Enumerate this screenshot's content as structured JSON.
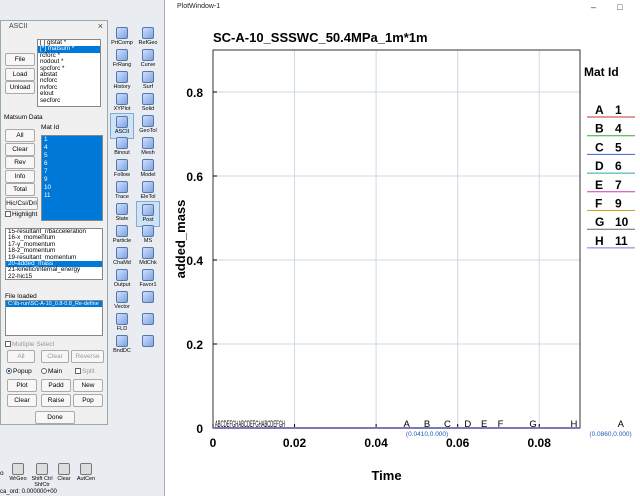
{
  "ascii_dialog": {
    "title": "ASCII",
    "close": "×",
    "file_buttons": [
      "File",
      "Load",
      "Unload"
    ],
    "file_list": [
      {
        "text": "[ ] glstat *",
        "selected": false
      },
      {
        "text": "[*] matsum *",
        "selected": true
      },
      {
        "text": "rcforc *",
        "selected": false
      },
      {
        "text": "nodout *",
        "selected": false
      },
      {
        "text": "spcforc *",
        "selected": false
      },
      {
        "text": "abstat",
        "selected": false
      },
      {
        "text": "ncforc",
        "selected": false
      },
      {
        "text": "nvforc",
        "selected": false
      },
      {
        "text": "elout",
        "selected": false
      },
      {
        "text": "secforc",
        "selected": false
      }
    ],
    "matsum_label": "Matsum Data",
    "mat_id_label": "Mat Id",
    "left_buttons": [
      "All",
      "Clear",
      "Rev",
      "Info",
      "Total",
      "Hic/Csi/Dri"
    ],
    "highlight_label": "Highlight",
    "mat_ids": [
      "1",
      "4",
      "5",
      "6",
      "7",
      "9",
      "10",
      "11"
    ],
    "component_list": [
      {
        "text": "15-resultant_r/bacceleration",
        "selected": false
      },
      {
        "text": "16-x_momentum",
        "selected": false
      },
      {
        "text": "17-y_momentum",
        "selected": false
      },
      {
        "text": "18-z_momentum",
        "selected": false
      },
      {
        "text": "19-resultant_momentum",
        "selected": false
      },
      {
        "text": "20-added_mass",
        "selected": true
      },
      {
        "text": "21-kinetic/internal_energy",
        "selected": false
      },
      {
        "text": "22-hic15",
        "selected": false
      }
    ],
    "file_loaded_label": "File loaded",
    "file_loaded_value": "C:\\lb-run\\SC-A-10_0.8-0.8_Re-define",
    "multiple_select_label": "Multiple Select",
    "ms_buttons": [
      "All",
      "Clear",
      "Reverse"
    ],
    "popup_label": "Popup",
    "main_label": "Main",
    "split_label": "Split",
    "action_buttons": [
      "Plot",
      "Padd",
      "New",
      "Clear",
      "Raise",
      "Pop"
    ],
    "done_label": "Done"
  },
  "toolbar": {
    "tools": [
      {
        "label": "PrtComp",
        "active": false
      },
      {
        "label": "RefGeo",
        "active": false
      },
      {
        "label": "FrRang",
        "active": false
      },
      {
        "label": "Curve",
        "active": false
      },
      {
        "label": "History",
        "active": false
      },
      {
        "label": "Surf",
        "active": false
      },
      {
        "label": "XYPlot",
        "active": false
      },
      {
        "label": "Solid",
        "active": false
      },
      {
        "label": "ASCII",
        "active": true
      },
      {
        "label": "GeoTol",
        "active": false
      },
      {
        "label": "Binout",
        "active": false
      },
      {
        "label": "Mesh",
        "active": false
      },
      {
        "label": "Follow",
        "active": false
      },
      {
        "label": "Model",
        "active": false
      },
      {
        "label": "Trace",
        "active": false
      },
      {
        "label": "EleTol",
        "active": false
      },
      {
        "label": "State",
        "active": false
      },
      {
        "label": "Post",
        "active": true
      },
      {
        "label": "Particle",
        "active": false
      },
      {
        "label": "MS",
        "active": false
      },
      {
        "label": "ChaMd",
        "active": false
      },
      {
        "label": "MdChk",
        "active": false
      },
      {
        "label": "Output",
        "active": false
      },
      {
        "label": "Favor1",
        "active": false
      },
      {
        "label": "Vector",
        "active": false
      },
      {
        "label": "",
        "active": false
      },
      {
        "label": "FLD",
        "active": false
      },
      {
        "label": "",
        "active": false
      },
      {
        "label": "BndDC",
        "active": false
      },
      {
        "label": "",
        "active": false
      }
    ]
  },
  "bottom_toolbar": [
    "WrGeo",
    "Shift Ctrl ShfCtr",
    "Clear",
    "AutCen"
  ],
  "bottom_status": "ca_ord: 0.000000+00",
  "bottom_left_label": "o",
  "plot_window": {
    "title": "PlotWindow-1",
    "minimize": "–",
    "maximize": "□"
  },
  "chart_data": {
    "type": "line",
    "title": "SC-A-10_SSSWC_50.4MPa_1m*1m",
    "xlabel": "Time",
    "ylabel": "added_mass",
    "xlim": [
      0,
      0.09
    ],
    "ylim": [
      0,
      0.9
    ],
    "xticks": [
      "0",
      "0.02",
      "0.04",
      "0.06",
      "0.08"
    ],
    "xtick_values": [
      0,
      0.02,
      0.04,
      0.06,
      0.08
    ],
    "yticks": [
      "0",
      "0.2",
      "0.4",
      "0.6",
      "0.8"
    ],
    "ytick_values": [
      0,
      0.2,
      0.4,
      0.6,
      0.8
    ],
    "grid": true,
    "legend_title": "Mat Id",
    "legend_position": "right",
    "series": [
      {
        "letter": "A",
        "name": "1",
        "color": "#c8322f",
        "x": [
          0,
          0.09
        ],
        "y": [
          0,
          0
        ]
      },
      {
        "letter": "B",
        "name": "4",
        "color": "#3aa63a",
        "x": [
          0,
          0.09
        ],
        "y": [
          0,
          0
        ]
      },
      {
        "letter": "C",
        "name": "5",
        "color": "#3b5fd6",
        "x": [
          0,
          0.09
        ],
        "y": [
          0,
          0
        ]
      },
      {
        "letter": "D",
        "name": "6",
        "color": "#26a6a6",
        "x": [
          0,
          0.09
        ],
        "y": [
          0,
          0
        ]
      },
      {
        "letter": "E",
        "name": "7",
        "color": "#c73fb3",
        "x": [
          0,
          0.09
        ],
        "y": [
          0,
          0
        ]
      },
      {
        "letter": "F",
        "name": "9",
        "color": "#c9a11e",
        "x": [
          0,
          0.09
        ],
        "y": [
          0,
          0
        ]
      },
      {
        "letter": "G",
        "name": "10",
        "color": "#666666",
        "x": [
          0,
          0.09
        ],
        "y": [
          0,
          0
        ]
      },
      {
        "letter": "H",
        "name": "11",
        "color": "#7a7ad6",
        "x": [
          0,
          0.09
        ],
        "y": [
          0,
          0
        ]
      }
    ],
    "curve_markers": [
      {
        "text": "A",
        "x": 0.0475
      },
      {
        "text": "B",
        "x": 0.0525
      },
      {
        "text": "C",
        "x": 0.0575
      },
      {
        "text": "D",
        "x": 0.0625
      },
      {
        "text": "E",
        "x": 0.0665
      },
      {
        "text": "F",
        "x": 0.0705
      },
      {
        "text": "G",
        "x": 0.0785
      },
      {
        "text": "H",
        "x": 0.0885
      },
      {
        "text": "A",
        "x": 0.1
      }
    ],
    "start_cluster_text": "ABCDEFGHABCDEFGHABCDEFGH",
    "annotations": [
      {
        "text": "(0.0410,0.000)",
        "x": 0.0525
      },
      {
        "text": "(0.0860,0.000)",
        "x": 0.0975
      }
    ]
  }
}
